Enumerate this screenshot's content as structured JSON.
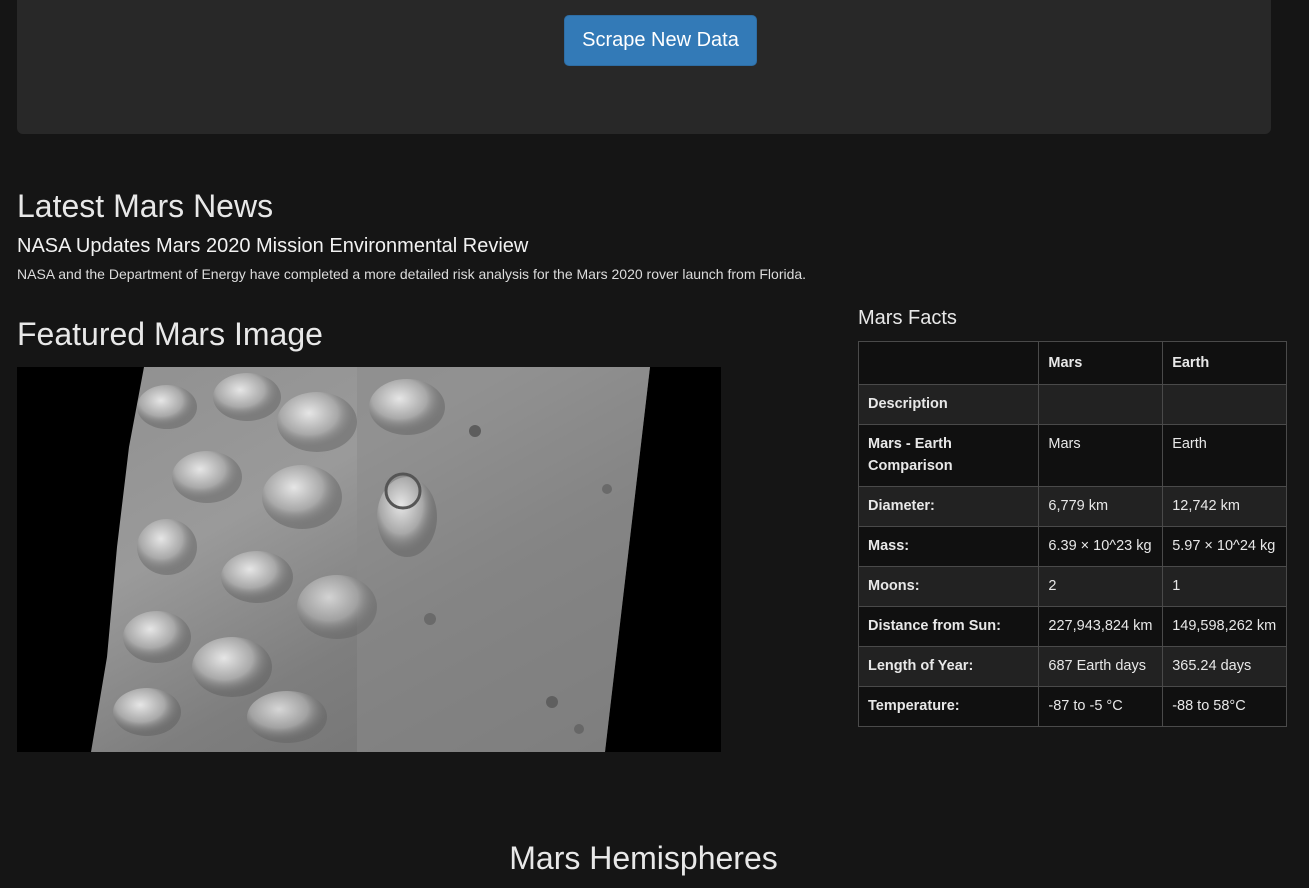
{
  "jumbotron": {
    "scrape_button_label": "Scrape New Data"
  },
  "news": {
    "heading": "Latest Mars News",
    "title": "NASA Updates Mars 2020 Mission Environmental Review",
    "paragraph": "NASA and the Department of Energy have completed a more detailed risk analysis for the Mars 2020 rover launch from Florida."
  },
  "featured": {
    "heading": "Featured Mars Image"
  },
  "facts": {
    "heading": "Mars Facts",
    "columns": [
      "",
      "Mars",
      "Earth"
    ],
    "rows": [
      {
        "label": "Description",
        "mars": "",
        "earth": ""
      },
      {
        "label": "Mars - Earth Comparison",
        "mars": "Mars",
        "earth": "Earth"
      },
      {
        "label": "Diameter:",
        "mars": "6,779 km",
        "earth": "12,742 km"
      },
      {
        "label": "Mass:",
        "mars": "6.39 × 10^23 kg",
        "earth": "5.97 × 10^24 kg"
      },
      {
        "label": "Moons:",
        "mars": "2",
        "earth": "1"
      },
      {
        "label": "Distance from Sun:",
        "mars": "227,943,824 km",
        "earth": "149,598,262 km"
      },
      {
        "label": "Length of Year:",
        "mars": "687 Earth days",
        "earth": "365.24 days"
      },
      {
        "label": "Temperature:",
        "mars": "-87 to -5 °C",
        "earth": "-88 to 58°C"
      }
    ]
  },
  "hemispheres": {
    "heading": "Mars Hemispheres"
  },
  "colors": {
    "page_background": "#151515",
    "jumbotron_background": "#282828",
    "button_primary": "#337ab7"
  }
}
